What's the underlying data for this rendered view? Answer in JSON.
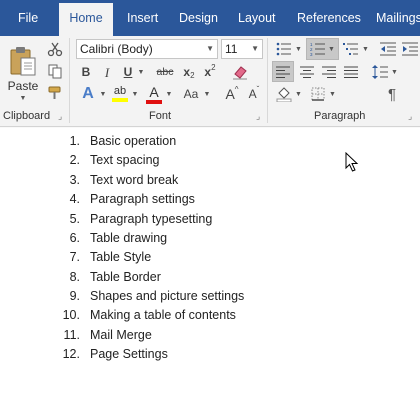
{
  "tabs": [
    {
      "label": "File"
    },
    {
      "label": "Home",
      "active": true
    },
    {
      "label": "Insert"
    },
    {
      "label": "Design"
    },
    {
      "label": "Layout"
    },
    {
      "label": "References"
    },
    {
      "label": "Mailings"
    }
  ],
  "clipboard": {
    "paste_label": "Paste",
    "group_label": "Clipboard"
  },
  "font": {
    "family_value": "Calibri (Body)",
    "size_value": "11",
    "bold": "B",
    "italic": "I",
    "underline": "U",
    "strikethrough": "abc",
    "subscript_base": "x",
    "subscript_mark": "2",
    "superscript_base": "x",
    "superscript_mark": "2",
    "text_effects": "A",
    "highlight": "ab",
    "font_color": "A",
    "change_case": "Aa",
    "grow": "A",
    "shrink": "A",
    "group_label": "Font",
    "highlight_color": "#ffff00",
    "font_color_bar": "#e01010"
  },
  "paragraph": {
    "show_marks": "¶",
    "group_label": "Paragraph",
    "numbering_pressed": true
  },
  "colors": {
    "title_bar": "#2b579a",
    "ribbon_bg": "#f3f3f3",
    "pressed": "#c8c8c8"
  },
  "document": {
    "list": [
      {
        "num": "1.",
        "text": "Basic operation"
      },
      {
        "num": "2.",
        "text": "Text spacing"
      },
      {
        "num": "3.",
        "text": "Text word break"
      },
      {
        "num": "4.",
        "text": "Paragraph settings"
      },
      {
        "num": "5.",
        "text": "Paragraph typesetting"
      },
      {
        "num": "6.",
        "text": "Table drawing"
      },
      {
        "num": "7.",
        "text": "Table Style"
      },
      {
        "num": "8.",
        "text": "Table Border"
      },
      {
        "num": "9.",
        "text": "Shapes and picture settings"
      },
      {
        "num": "10.",
        "text": "Making a table of contents"
      },
      {
        "num": "11.",
        "text": "Mail Merge"
      },
      {
        "num": "12.",
        "text": "Page Settings"
      }
    ]
  }
}
